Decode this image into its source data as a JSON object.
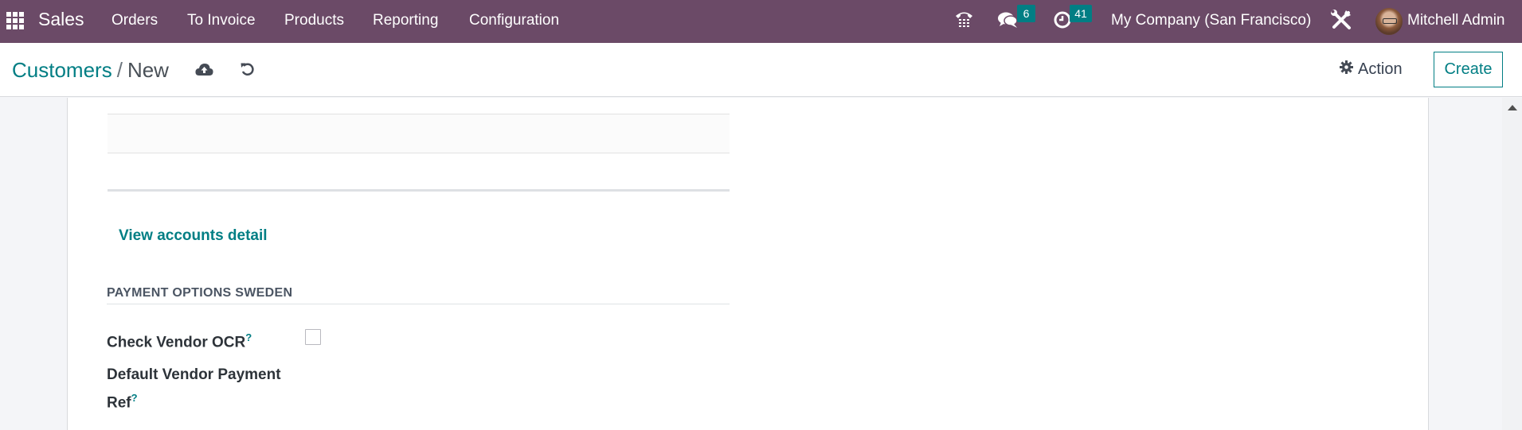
{
  "navbar": {
    "app_name": "Sales",
    "menu": [
      {
        "label": "Orders"
      },
      {
        "label": "To Invoice"
      },
      {
        "label": "Products"
      },
      {
        "label": "Reporting"
      },
      {
        "label": "Configuration"
      }
    ],
    "icons": {
      "apps": "apps-grid-icon",
      "phone": "phone-icon",
      "messages": "chat-icon",
      "activities": "clock-icon",
      "settings": "tools-icon"
    },
    "messages_count": "6",
    "activities_count": "41",
    "company": "My Company (San Francisco)",
    "user_name": "Mitchell Admin"
  },
  "control_panel": {
    "breadcrumb": {
      "parent": "Customers",
      "separator": "/",
      "current": "New"
    },
    "save_icon": "cloud-upload-icon",
    "discard_icon": "undo-icon",
    "action_label": "Action",
    "create_label": "Create"
  },
  "form": {
    "view_accounts_link": "View accounts detail",
    "section_title": "PAYMENT OPTIONS SWEDEN",
    "fields": [
      {
        "label": "Check Vendor OCR",
        "help": "?",
        "type": "checkbox",
        "checked": false
      },
      {
        "label_line1": "Default Vendor Payment",
        "label_line2": "Ref",
        "help": "?",
        "type": "text",
        "value": ""
      }
    ]
  },
  "colors": {
    "navbar_bg": "#6b4a67",
    "accent": "#017e84",
    "badge_bg": "#017e84"
  }
}
